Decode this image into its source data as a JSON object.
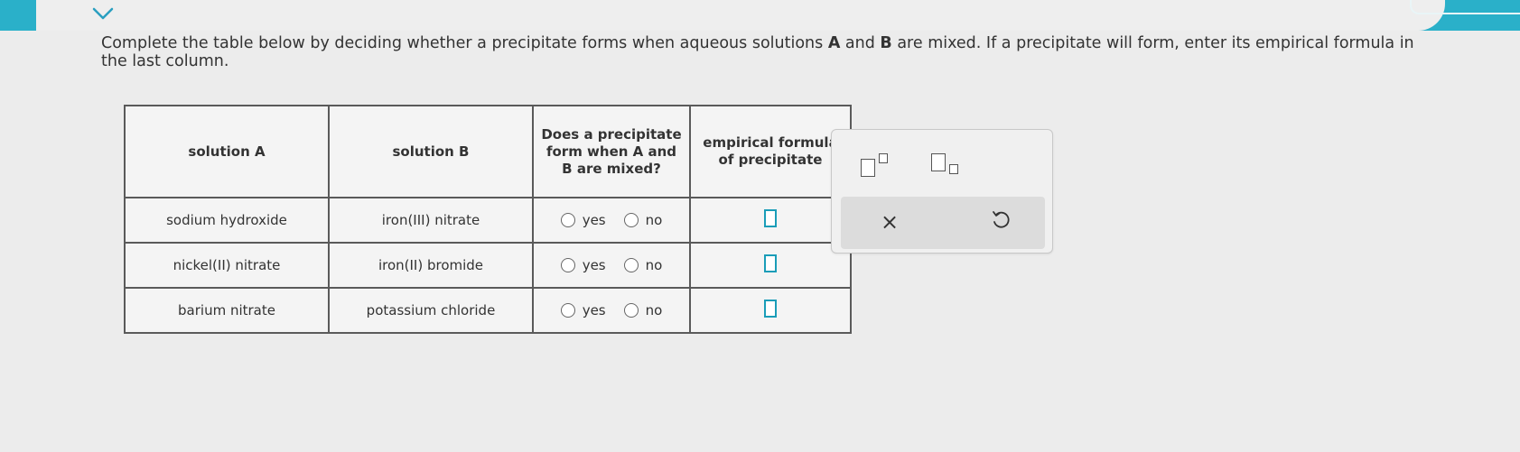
{
  "instructions": {
    "part1": "Complete the table below by deciding whether a precipitate forms when aqueous solutions ",
    "a": "A",
    "and": " and ",
    "b": "B",
    "part2": " are mixed. If a precipitate will form, enter its empirical formula in the last column."
  },
  "table": {
    "headers": {
      "solution_a": "solution A",
      "solution_b": "solution B",
      "precipitate_question": "Does a precipitate form when A and B are mixed?",
      "formula": "empirical formula of precipitate"
    },
    "rows": [
      {
        "solution_a": "sodium hydroxide",
        "solution_b": "iron(III) nitrate",
        "yes": "yes",
        "no": "no"
      },
      {
        "solution_a": "nickel(II) nitrate",
        "solution_b": "iron(II) bromide",
        "yes": "yes",
        "no": "no"
      },
      {
        "solution_a": "barium nitrate",
        "solution_b": "potassium chloride",
        "yes": "yes",
        "no": "no"
      }
    ]
  },
  "palette": {
    "clear_symbol": "×"
  },
  "colors": {
    "topbar": "#2ab0c9",
    "answer_box_border": "#1a9db8"
  }
}
